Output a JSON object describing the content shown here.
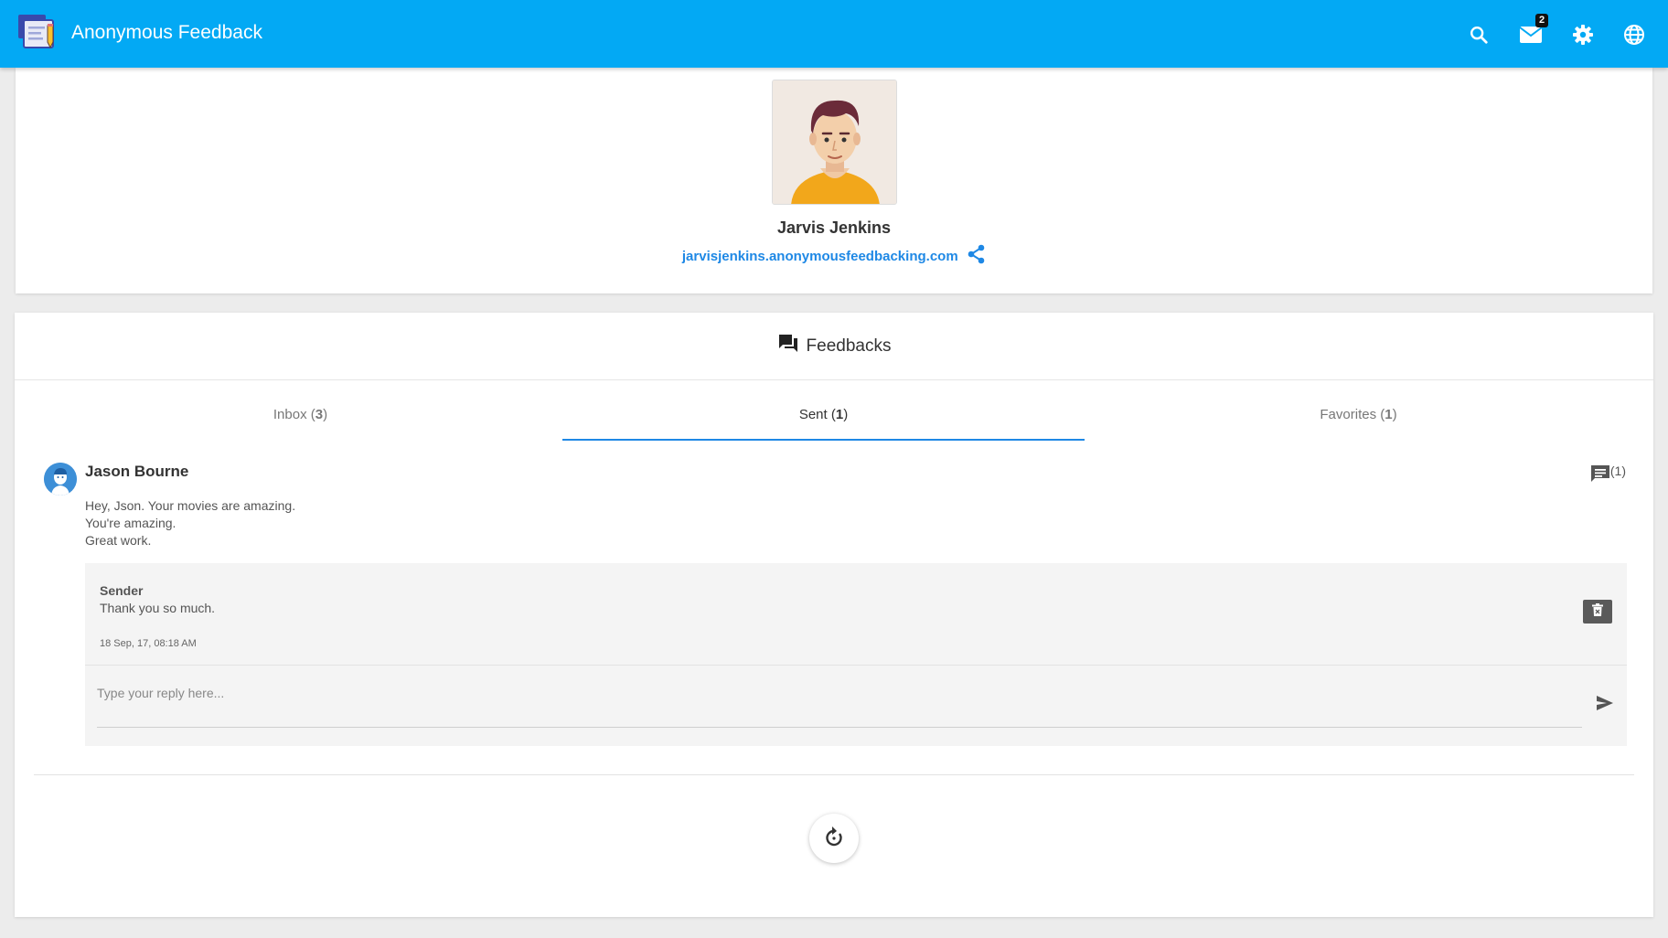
{
  "app": {
    "title": "Anonymous Feedback"
  },
  "topbar": {
    "icons": [
      "search-icon",
      "mail-icon",
      "gear-icon",
      "globe-icon"
    ],
    "mail_badge": "2",
    "color": "#03a9f4"
  },
  "profile": {
    "name": "Jarvis Jenkins",
    "link": "jarvisjenkins.anonymousfeedbacking.com",
    "avatar": "man-avatar-illustration"
  },
  "feedbacks": {
    "header": "Feedbacks",
    "tabs": [
      {
        "label": "Inbox (",
        "count": "3",
        "close": ")",
        "active": false
      },
      {
        "label": "Sent (",
        "count": "1",
        "close": ")",
        "active": true
      },
      {
        "label": "Favorites (",
        "count": "1",
        "close": ")",
        "active": false
      }
    ],
    "item": {
      "recipient": "Jason Bourne",
      "comments": "(1)",
      "message_lines": [
        "Hey, Json. Your movies are amazing.",
        "You're amazing.",
        "Great work."
      ],
      "reply": {
        "sender_label": "Sender",
        "text": "Thank you so much.",
        "timestamp": "18 Sep, 17, 08:18 AM"
      },
      "reply_placeholder": "Type your reply here..."
    }
  },
  "colors": {
    "accent": "#1e88e5",
    "appbar": "#03a9f4"
  }
}
